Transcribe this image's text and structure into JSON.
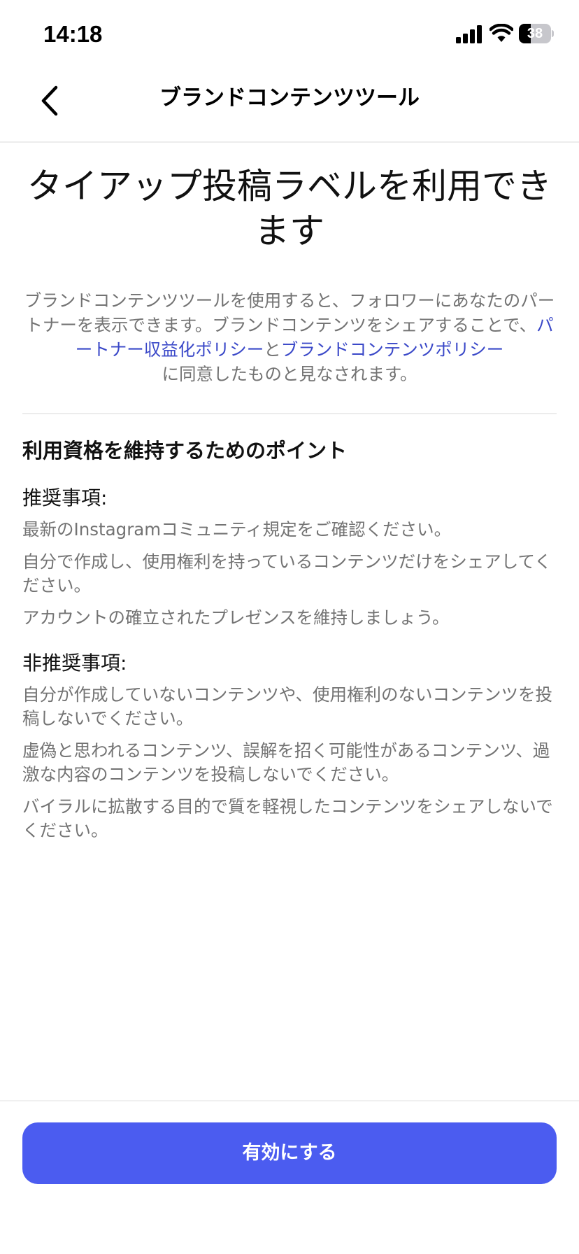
{
  "status_bar": {
    "time": "14:18",
    "battery_percent": 38,
    "icons": [
      "signal-icon",
      "wifi-icon",
      "battery-icon"
    ]
  },
  "nav": {
    "back_icon": "chevron-left-icon",
    "title": "ブランドコンテンツツール"
  },
  "main": {
    "headline": "タイアップ投稿ラベルを利用できます",
    "intro": {
      "text_1": "ブランドコンテンツツールを使用すると、フォロワーにあなたのパートナーを表示できます。ブランドコンテンツをシェアすることで、",
      "link_1": "パートナー収益化ポリシー",
      "text_2": "と",
      "link_2": "ブランドコンテンツポリシー",
      "text_3": "に同意したものと見なされます。"
    },
    "points_heading": "利用資格を維持するためのポイント",
    "dos": {
      "heading": "推奨事項:",
      "items": [
        "最新のInstagramコミュニティ規定をご確認ください。",
        "自分で作成し、使用権利を持っているコンテンツだけをシェアしてください。",
        "アカウントの確立されたプレゼンスを維持しましょう。"
      ]
    },
    "donts": {
      "heading": "非推奨事項:",
      "items": [
        "自分が作成していないコンテンツや、使用権利のないコンテンツを投稿しないでください。",
        "虚偽と思われるコンテンツ、誤解を招く可能性があるコンテンツ、過激な内容のコンテンツを投稿しないでください。",
        "バイラルに拡散する目的で質を軽視したコンテンツをシェアしないでください。"
      ]
    }
  },
  "footer": {
    "enable_label": "有効にする"
  },
  "colors": {
    "accent": "#4b5cf0",
    "link": "#3a48c8",
    "secondary_text": "#737373"
  }
}
